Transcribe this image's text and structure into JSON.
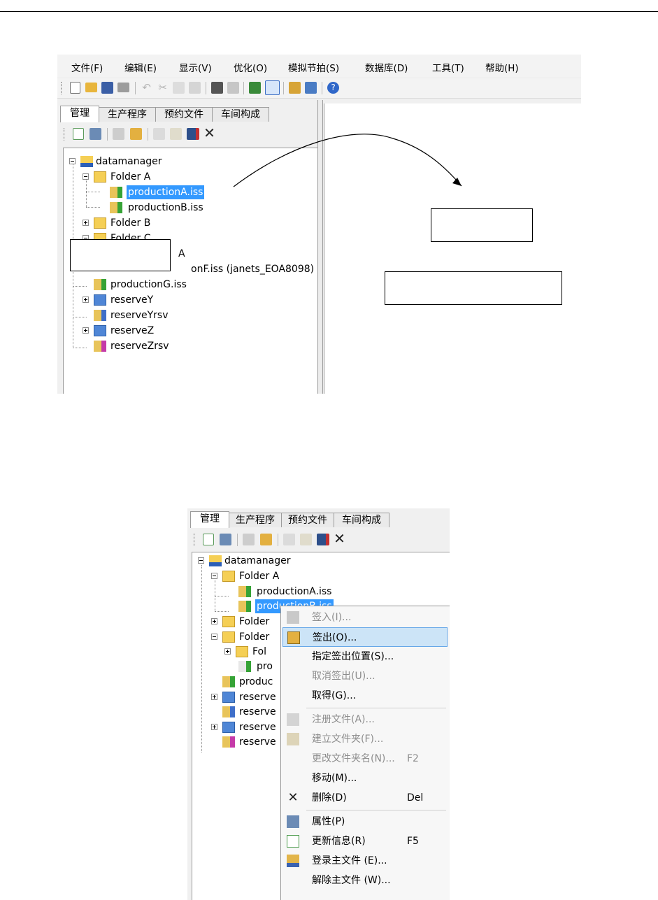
{
  "menu": [
    "文件(F)",
    "编辑(E)",
    "显示(V)",
    "优化(O)",
    "模拟节拍(S)",
    "数据库(D)",
    "工具(T)",
    "帮助(H)"
  ],
  "tabs": [
    "管理",
    "生产程序",
    "预约文件",
    "车间构成"
  ],
  "tree": {
    "root": "datamanager",
    "folder_a": "Folder A",
    "prod_a": "productionA.iss",
    "prod_b": "productionB.iss",
    "folder_b": "Folder B",
    "folder_c": "Folder C",
    "sub_a": "A",
    "prod_f": "onF.iss (janets_EOA8098)",
    "prod_g": "productionG.iss",
    "res_y": "reserveY",
    "res_y_rsv": "reserveYrsv",
    "res_z": "reserveZ",
    "res_z_rsv": "reserveZrsv"
  },
  "tree2": {
    "root": "datamanager",
    "folder_a": "Folder A",
    "prod_a": "productionA.iss",
    "prod_b": "productionB.iss",
    "folder_b": "Folder",
    "folder_c": "Folder",
    "fol": "Fol",
    "pro": "pro",
    "produc": "produc",
    "res1": "reserve",
    "res2": "reserve",
    "res3": "reserve",
    "res4": "reserve"
  },
  "context_menu": [
    {
      "label": "签入(I)...",
      "shortcut": "",
      "icon": "checkin-icon",
      "disabled": true
    },
    {
      "label": "签出(O)...",
      "shortcut": "",
      "icon": "checkout-icon",
      "disabled": false,
      "highlighted": true
    },
    {
      "label": "指定签出位置(S)...",
      "shortcut": "",
      "icon": "",
      "disabled": false
    },
    {
      "label": "取消签出(U)...",
      "shortcut": "",
      "icon": "",
      "disabled": true
    },
    {
      "label": "取得(G)...",
      "shortcut": "",
      "icon": "",
      "disabled": false
    },
    {
      "label": "注册文件(A)...",
      "shortcut": "",
      "icon": "register-file-icon",
      "disabled": true
    },
    {
      "label": "建立文件夹(F)...",
      "shortcut": "",
      "icon": "new-folder-icon",
      "disabled": true
    },
    {
      "label": "更改文件夹名(N)...",
      "shortcut": "F2",
      "icon": "",
      "disabled": true
    },
    {
      "label": "移动(M)...",
      "shortcut": "",
      "icon": "",
      "disabled": false
    },
    {
      "label": "删除(D)",
      "shortcut": "Del",
      "icon": "delete-icon",
      "disabled": false
    },
    {
      "label": "属性(P)",
      "shortcut": "",
      "icon": "properties-icon",
      "disabled": false
    },
    {
      "label": "更新信息(R)",
      "shortcut": "F5",
      "icon": "refresh-icon",
      "disabled": false
    },
    {
      "label": "登录主文件 (E)...",
      "shortcut": "",
      "icon": "register-master-icon",
      "disabled": false
    },
    {
      "label": "解除主文件 (W)...",
      "shortcut": "",
      "icon": "",
      "disabled": false
    }
  ],
  "colors": {
    "selection": "#3399ff",
    "menu_highlight": "#cce4f7",
    "folder_yellow": "#f5cf55",
    "reserve_blue": "#4f86d6"
  }
}
